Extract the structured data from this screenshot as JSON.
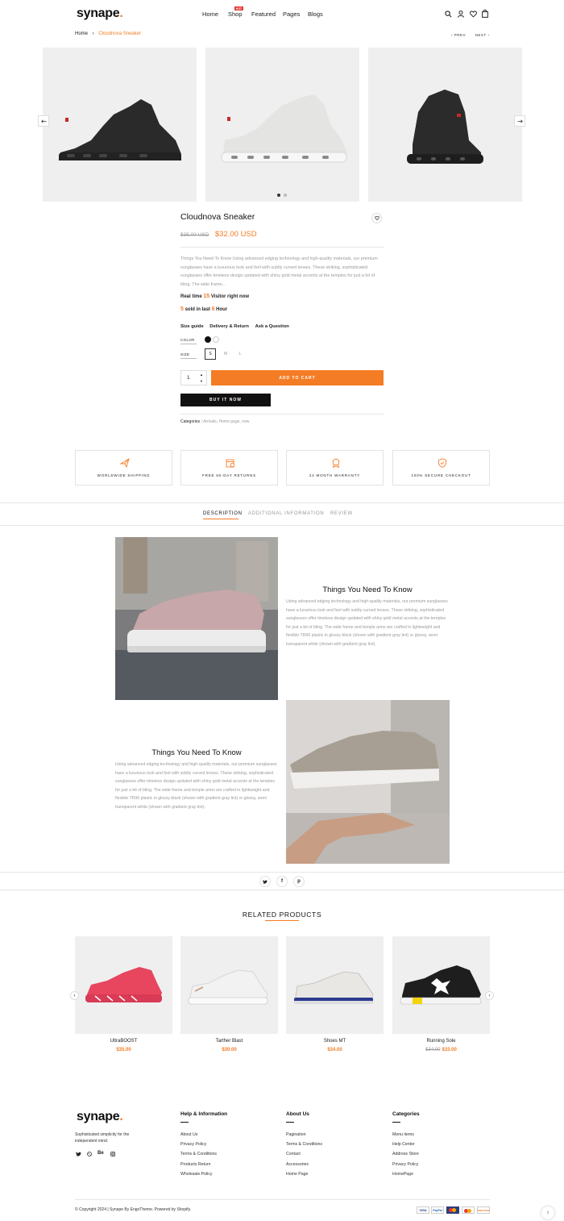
{
  "brand": {
    "name": "synape",
    "dot": "."
  },
  "nav": {
    "items": [
      {
        "label": "Home"
      },
      {
        "label": "Shop",
        "badge": "HOT"
      },
      {
        "label": "Featured"
      },
      {
        "label": "Pages"
      },
      {
        "label": "Blogs"
      }
    ]
  },
  "breadcrumb": {
    "home": "Home",
    "sep": "›",
    "current": "Cloudnova Sneaker"
  },
  "pager": {
    "prev": "PREV",
    "next": "NEXT"
  },
  "product": {
    "title": "Cloudnova Sneaker",
    "old_price": "$35.00 USD",
    "price": "$32.00 USD",
    "description": "Things You Need To Know Using advanced edging technology and high-quality materials, our premium sunglasses have a luxurious look and feel with subtly curved lenses. These striking, sophisticated sunglasses offer timeless design updated with shiny gold metal accents at the temples for just a hit of bling. The wide frame...",
    "realtime": {
      "prefix": "Real time",
      "count": "15",
      "suffix": "Visitor right now"
    },
    "sold": {
      "count": "5",
      "middle": "sold in last",
      "hours": "6",
      "suffix": "Hour"
    },
    "links": [
      "Size guide",
      "Delivery & Return",
      "Ask a Question"
    ],
    "color_label": "COLOR",
    "size_label": "SIZE",
    "sizes": [
      "S",
      "M",
      "L"
    ],
    "quantity": "1",
    "add_to_cart": "ADD TO CART",
    "buy_now": "BUY IT NOW",
    "categories_label": "Categories :",
    "categories_value": "Arrivals, Home page, new",
    "colors": [
      "#111111",
      "#ffffff"
    ],
    "accent": "#f47c25"
  },
  "features": [
    {
      "label": "WORLDWIDE SHIPPING",
      "icon": "plane-icon"
    },
    {
      "label": "FREE 60-DAY RETURNS",
      "icon": "calendar-return-icon"
    },
    {
      "label": "24 MONTH WARRANTY",
      "icon": "badge-icon"
    },
    {
      "label": "100% SECURE CHECKOUT",
      "icon": "shield-check-icon"
    }
  ],
  "tabs": [
    "DESCRIPTION",
    "ADDITIONAL INFORMATION",
    "REVIEW"
  ],
  "desc_blocks": [
    {
      "heading": "Things You Need To Know",
      "text": "Using advanced edging technology and high-quality materials, our premium sunglasses have a luxurious look and feel with subtly curved lenses. These striking, sophisticated sunglasses offer timeless design updated with shiny gold metal accents at the temples for just a bit of bling. The wide frame and temple arms are crafted in lightweight and flexible TR90 plastic in glossy black (shown with gradient gray tint) or glossy, semi transparent white (shown with gradient gray tint)."
    },
    {
      "heading": "Things You Need To Know",
      "text": "Using advanced edging technology and high-quality materials, our premium sunglasses have a luxurious look and feel with subtly curved lenses. These striking, sophisticated sunglasses offer timeless design updated with shiny gold metal accents at the temples for just a bit of bling. The wide frame and temple arms are crafted in lightweight and flexible TR90 plastic in glossy black (shown with gradient gray tint) or glossy, semi transparent white (shown with gradient gray tint)."
    }
  ],
  "share": [
    "twitter-icon",
    "facebook-icon",
    "pinterest-icon"
  ],
  "related": {
    "heading": "RELATED PRODUCTS",
    "items": [
      {
        "name": "UltraBOOST",
        "old": "",
        "price": "$35.00"
      },
      {
        "name": "Tarther Blast",
        "old": "",
        "price": "$30.00"
      },
      {
        "name": "Shoes MT",
        "old": "",
        "price": "$34.00"
      },
      {
        "name": "Running Sole",
        "old": "$34.00",
        "price": "$33.00"
      }
    ]
  },
  "footer": {
    "tagline": "Sophisticated simplicity for the independent mind.",
    "columns": [
      {
        "title": "Help & Information",
        "links": [
          "About Us",
          "Privacy Policy",
          "Terms & Conditions",
          "Products Return",
          "Wholesale Policy"
        ]
      },
      {
        "title": "About Us",
        "links": [
          "Pagination",
          "Terms & Conditions",
          "Contact",
          "Accessories",
          "Home Page"
        ]
      },
      {
        "title": "Categories",
        "links": [
          "Menu items",
          "Help Center",
          "Address Store",
          "Privacy Policy",
          "HomePage"
        ]
      }
    ],
    "social": [
      "twitter-icon",
      "dribbble-icon",
      "behance-icon",
      "instagram-icon"
    ],
    "behance_text": "Be",
    "copyright": "© Copyright 2024 | Synape By EngoTheme. Powered by Shopify.",
    "payments": [
      "VISA",
      "PayPal",
      "MC",
      "MC",
      "DISCOVER"
    ],
    "back_to_top": "↑"
  }
}
